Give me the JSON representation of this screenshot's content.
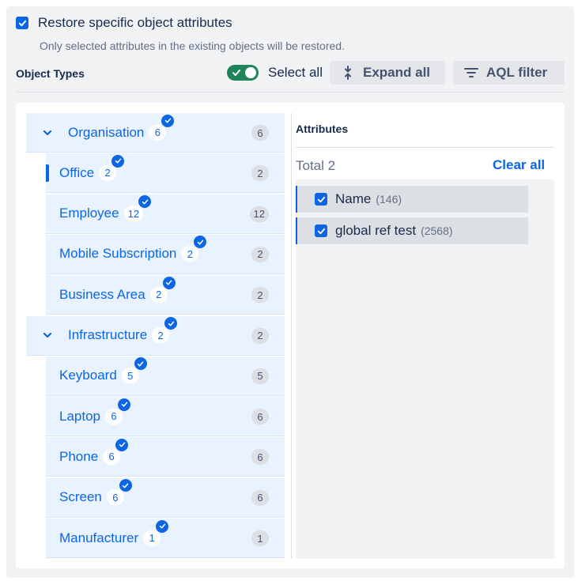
{
  "restore": {
    "label": "Restore specific object attributes",
    "description": "Only selected attributes in the existing objects will be restored.",
    "checked": true
  },
  "object_types": {
    "header": "Object Types",
    "select_all_label": "Select all",
    "expand_all_label": "Expand all",
    "aql_filter_label": "AQL filter"
  },
  "tree": [
    {
      "label": "Organisation",
      "selected": "6",
      "count": "6",
      "level": "parent"
    },
    {
      "label": "Office",
      "selected": "2",
      "count": "2",
      "level": "child",
      "active": true
    },
    {
      "label": "Employee",
      "selected": "12",
      "count": "12",
      "level": "child"
    },
    {
      "label": "Mobile Subscription",
      "selected": "2",
      "count": "2",
      "level": "child"
    },
    {
      "label": "Business Area",
      "selected": "2",
      "count": "2",
      "level": "child"
    },
    {
      "label": "Infrastructure",
      "selected": "2",
      "count": "2",
      "level": "parent"
    },
    {
      "label": "Keyboard",
      "selected": "5",
      "count": "5",
      "level": "child"
    },
    {
      "label": "Laptop",
      "selected": "6",
      "count": "6",
      "level": "child"
    },
    {
      "label": "Phone",
      "selected": "6",
      "count": "6",
      "level": "child"
    },
    {
      "label": "Screen",
      "selected": "6",
      "count": "6",
      "level": "child"
    },
    {
      "label": "Manufacturer",
      "selected": "1",
      "count": "1",
      "level": "child"
    }
  ],
  "attributes": {
    "title": "Attributes",
    "total": "Total 2",
    "clear_all": "Clear all",
    "items": [
      {
        "name": "Name",
        "count": "(146)",
        "checked": true
      },
      {
        "name": "global ref test",
        "count": "(2568)",
        "checked": true
      }
    ]
  },
  "colors": {
    "accent": "#0c66e4",
    "toggle_on": "#1f845a",
    "row_bg": "#e9f2ff",
    "panel_bg": "#f1f2f4"
  }
}
